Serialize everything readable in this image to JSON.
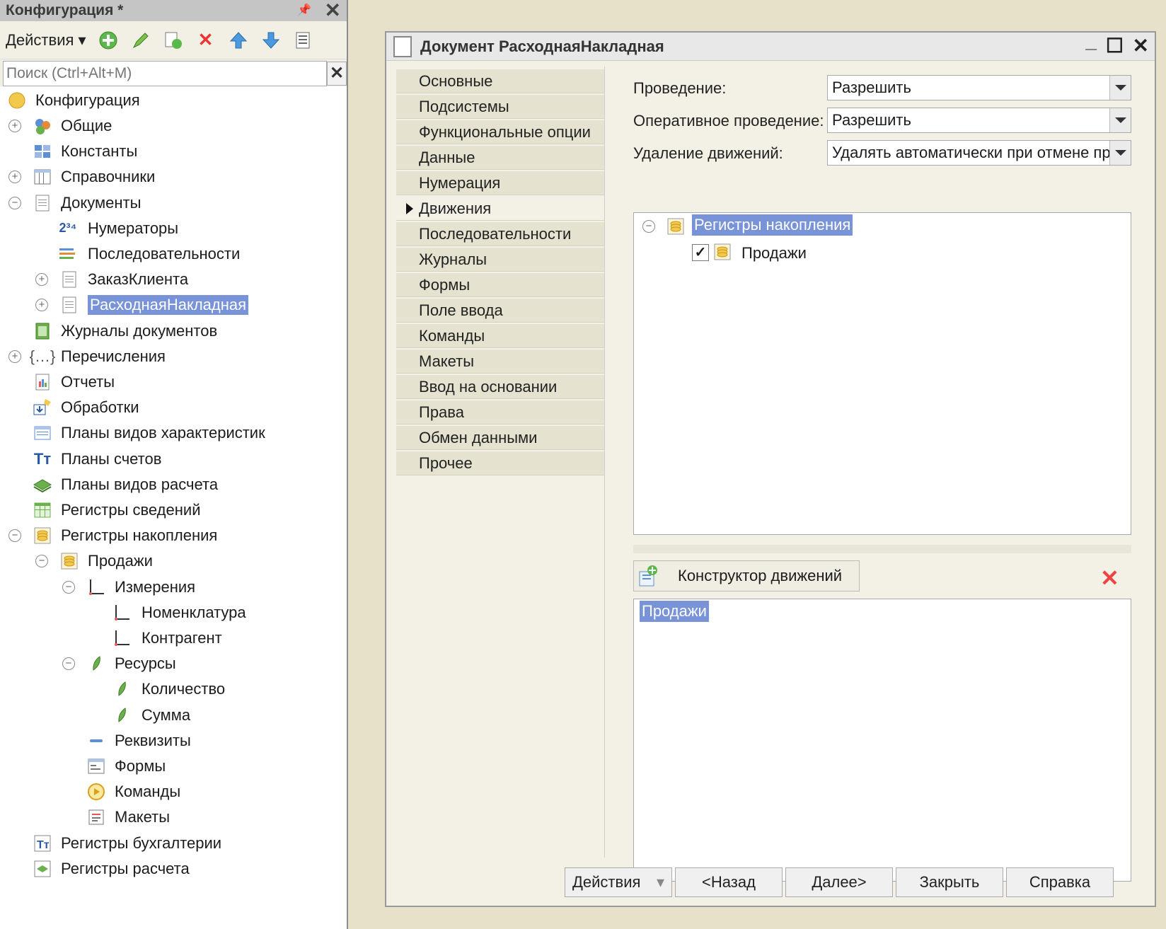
{
  "left_panel": {
    "title": "Конфигурация *",
    "pin": "ꟷ",
    "actions_label": "Действия",
    "search_placeholder": "Поиск (Ctrl+Alt+M)",
    "tree": [
      {
        "label": "Конфигурация"
      },
      {
        "label": "Общие"
      },
      {
        "label": "Константы"
      },
      {
        "label": "Справочники"
      },
      {
        "label": "Документы"
      },
      {
        "label": "Нумераторы"
      },
      {
        "label": "Последовательности"
      },
      {
        "label": "ЗаказКлиента"
      },
      {
        "label": "РасходнаяНакладная"
      },
      {
        "label": "Журналы документов"
      },
      {
        "label": "Перечисления"
      },
      {
        "label": "Отчеты"
      },
      {
        "label": "Обработки"
      },
      {
        "label": "Планы видов характеристик"
      },
      {
        "label": "Планы счетов"
      },
      {
        "label": "Планы видов расчета"
      },
      {
        "label": "Регистры сведений"
      },
      {
        "label": "Регистры накопления"
      },
      {
        "label": "Продажи"
      },
      {
        "label": "Измерения"
      },
      {
        "label": "Номенклатура"
      },
      {
        "label": "Контрагент"
      },
      {
        "label": "Ресурсы"
      },
      {
        "label": "Количество"
      },
      {
        "label": "Сумма"
      },
      {
        "label": "Реквизиты"
      },
      {
        "label": "Формы"
      },
      {
        "label": "Команды"
      },
      {
        "label": "Макеты"
      },
      {
        "label": "Регистры бухгалтерии"
      },
      {
        "label": "Регистры расчета"
      }
    ]
  },
  "window": {
    "title": "Документ РасходнаяНакладная",
    "tabs": [
      "Основные",
      "Подсистемы",
      "Функциональные опции",
      "Данные",
      "Нумерация",
      "Движения",
      "Последовательности",
      "Журналы",
      "Формы",
      "Поле ввода",
      "Команды",
      "Макеты",
      "Ввод на основании",
      "Права",
      "Обмен данными",
      "Прочее"
    ],
    "active_tab": "Движения",
    "fields": {
      "posting_label": "Проведение:",
      "posting_value": "Разрешить",
      "realtime_label": "Оперативное проведение:",
      "realtime_value": "Разрешить",
      "delete_label": "Удаление движений:",
      "delete_value": "Удалять автоматически при отмене проведения"
    },
    "registers_tree": {
      "group": "Регистры накопления",
      "item": "Продажи",
      "item_checked": true
    },
    "constructor_button": "Конструктор движений",
    "movements_list": [
      "Продажи"
    ],
    "buttons": {
      "actions": "Действия",
      "back": "<Назад",
      "next": "Далее>",
      "close": "Закрыть",
      "help": "Справка"
    }
  },
  "colors": {
    "selection": "#7893d8",
    "background": "#f3f1e6",
    "desktop": "#e6e1c8"
  }
}
